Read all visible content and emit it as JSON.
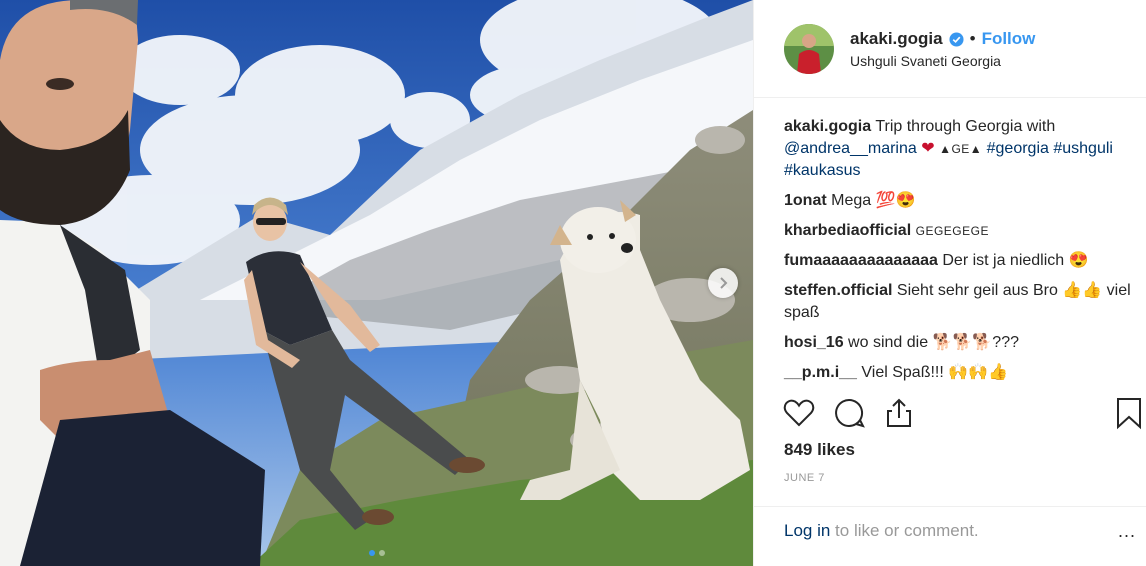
{
  "post": {
    "username": "akaki.gogia",
    "separator": "•",
    "follow_label": "Follow",
    "location": "Ushguli Svaneti Georgia",
    "likes": "849 likes",
    "date": "JUNE 7",
    "login_link": "Log in",
    "login_rest": " to like or comment.",
    "more_label": "..."
  },
  "caption": {
    "user": "akaki.gogia",
    "text": "Trip through Georgia with",
    "mention": "@andrea__marina",
    "heart": "❤",
    "flag": "▲GE▲",
    "tag1": "#georgia",
    "tag2": "#ushguli",
    "tag3": "#kaukasus"
  },
  "comments": [
    {
      "user": "1onat",
      "text": "Mega 💯😍"
    },
    {
      "user": "kharbediaofficial",
      "text": "GEGEGEGE"
    },
    {
      "user": "fumaaaaaaaaaaaaaa",
      "text": "Der ist ja niedlich 😍"
    },
    {
      "user": "steffen.official",
      "text": "Sieht sehr geil aus Bro 👍👍 viel spaß"
    },
    {
      "user": "hosi_16",
      "text": "wo sind die 🐕🐕🐕???"
    },
    {
      "user": "__p.m.i__",
      "text": "Viel Spaß!!! 🙌🙌👍"
    }
  ],
  "icons": {
    "like": "heart-icon",
    "comment": "comment-icon",
    "share": "share-icon",
    "save": "bookmark-icon",
    "next": "chevron-right-icon",
    "verified": "verified-badge-icon"
  },
  "colors": {
    "accent": "#3897f0",
    "link": "#003569",
    "muted": "#999999"
  }
}
